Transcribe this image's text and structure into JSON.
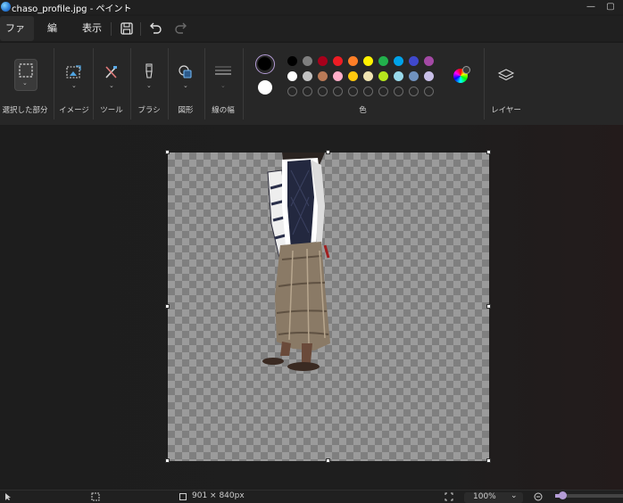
{
  "window": {
    "title": "chaso_profile.jpg - ペイント",
    "minimize_icon": "minimize-icon",
    "maximize_icon": "maximize-icon"
  },
  "menu": {
    "items": [
      "ファイル",
      "編集",
      "表示"
    ],
    "active": "ファイル",
    "quick_actions": [
      "save-icon",
      "undo-icon",
      "redo-icon"
    ]
  },
  "ribbon": {
    "groups": [
      {
        "label": "選択した部分",
        "icon": "selection-icon"
      },
      {
        "label": "イメージ",
        "icon": "image-icon"
      },
      {
        "label": "ツール",
        "icon": "tools-icon"
      },
      {
        "label": "ブラシ",
        "icon": "brush-icon"
      },
      {
        "label": "図形",
        "icon": "shapes-icon"
      },
      {
        "label": "線の幅",
        "icon": "line-width-icon"
      },
      {
        "label": "色",
        "icon": "color-palette"
      },
      {
        "label": "レイヤー",
        "icon": "layers-icon"
      }
    ],
    "colors": {
      "primary": "#000000",
      "secondary": "#ffffff",
      "row1": [
        "#000000",
        "#7f7f7f",
        "#a8001b",
        "#ee1c24",
        "#ff7f27",
        "#fff200",
        "#22b14c",
        "#00a2e8",
        "#3f48cc",
        "#a349a4"
      ],
      "row2": [
        "#ffffff",
        "#c3c3c3",
        "#b97a57",
        "#ffaec9",
        "#ffc90e",
        "#efe4b0",
        "#b5e61d",
        "#99d9ea",
        "#7092be",
        "#c8bfe7"
      ],
      "row3_empty_count": 10,
      "edit_colors_icon": "color-wheel-icon"
    }
  },
  "canvas": {
    "content": "cut-out photo of a person wearing a striped jacket, dark vest, patterned long skirt and sandals on a transparent background"
  },
  "status": {
    "cursor_icon": "pointer-icon",
    "selection_icon": "selection-size-icon",
    "image_size": "901 × 840px",
    "zoom": "100%",
    "fit_icon": "fit-to-window-icon",
    "zoom_out_icon": "zoom-out-icon"
  }
}
